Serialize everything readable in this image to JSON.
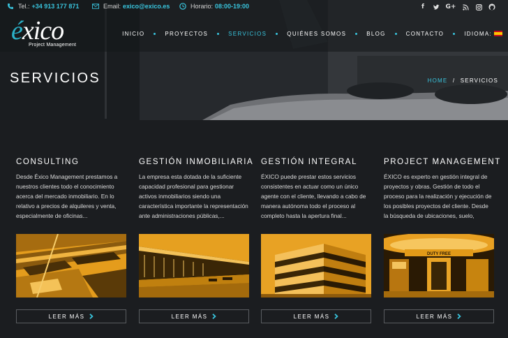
{
  "topbar": {
    "phone_label": "Tel.:",
    "phone_value": "+34 913 177 871",
    "email_label": "Email:",
    "email_value": "exico@exico.es",
    "hours_label": "Horario:",
    "hours_value": "08:00-19:00",
    "social_icons": [
      "facebook-icon",
      "twitter-icon",
      "google-plus-icon",
      "rss-icon",
      "instagram-icon",
      "github-icon"
    ]
  },
  "logo": {
    "brand_e": "é",
    "brand_rest": "xico",
    "tagline": "Project Management"
  },
  "nav": {
    "items": [
      {
        "label": "INICIO",
        "active": false
      },
      {
        "label": "PROYECTOS",
        "active": false
      },
      {
        "label": "SERVICIOS",
        "active": true
      },
      {
        "label": "QUIÉNES SOMOS",
        "active": false
      },
      {
        "label": "BLOG",
        "active": false
      },
      {
        "label": "CONTACTO",
        "active": false
      }
    ],
    "language_label": "IDIOMA:",
    "language_flag": "spain-flag-icon"
  },
  "hero": {
    "title": "SERVICIOS",
    "breadcrumb_home": "HOME",
    "breadcrumb_separator": "/",
    "breadcrumb_current": "SERVICIOS"
  },
  "services": [
    {
      "title": "CONSULTING",
      "text": "Desde Éxico Management prestamos a nuestros clientes todo el conocimiento acerca del mercado inmobiliario. En lo relativo a precios de alquileres y venta, especialmente de oficinas...",
      "image": "industrial-estate-aerial-photo",
      "button": "LEER MÁS"
    },
    {
      "title": "GESTIÓN INMOBILIARIA",
      "text": "La empresa esta dotada de la suficiente capacidad profesional para gestionar activos inmobiliarios siendo una característica importante la representación ante administraciones públicas,...",
      "image": "warehouse-building-photo",
      "button": "LEER MÁS"
    },
    {
      "title": "GESTIÓN INTEGRAL",
      "text": "ÉXICO puede prestar estos servicios consistentes en actuar como un único agente con el cliente, llevando a cabo de manera autónoma todo el proceso al completo hasta la apertura final...",
      "image": "office-building-photo",
      "button": "LEER MÁS"
    },
    {
      "title": "PROJECT MANAGEMENT",
      "text": "ÉXICO es experto en gestión integral de proyectos y obras. Gestión de todo el proceso para la realización y ejecución de los posibles proyectos del cliente. Desde la búsqueda de ubicaciones, suelo, locales,...",
      "image": "duty-free-store-photo",
      "image_sign": "DUTY FREE",
      "button": "LEER MÁS"
    }
  ],
  "colors": {
    "accent": "#39c5de",
    "background": "#1b1d20",
    "photo_tint": "#e29a18"
  }
}
